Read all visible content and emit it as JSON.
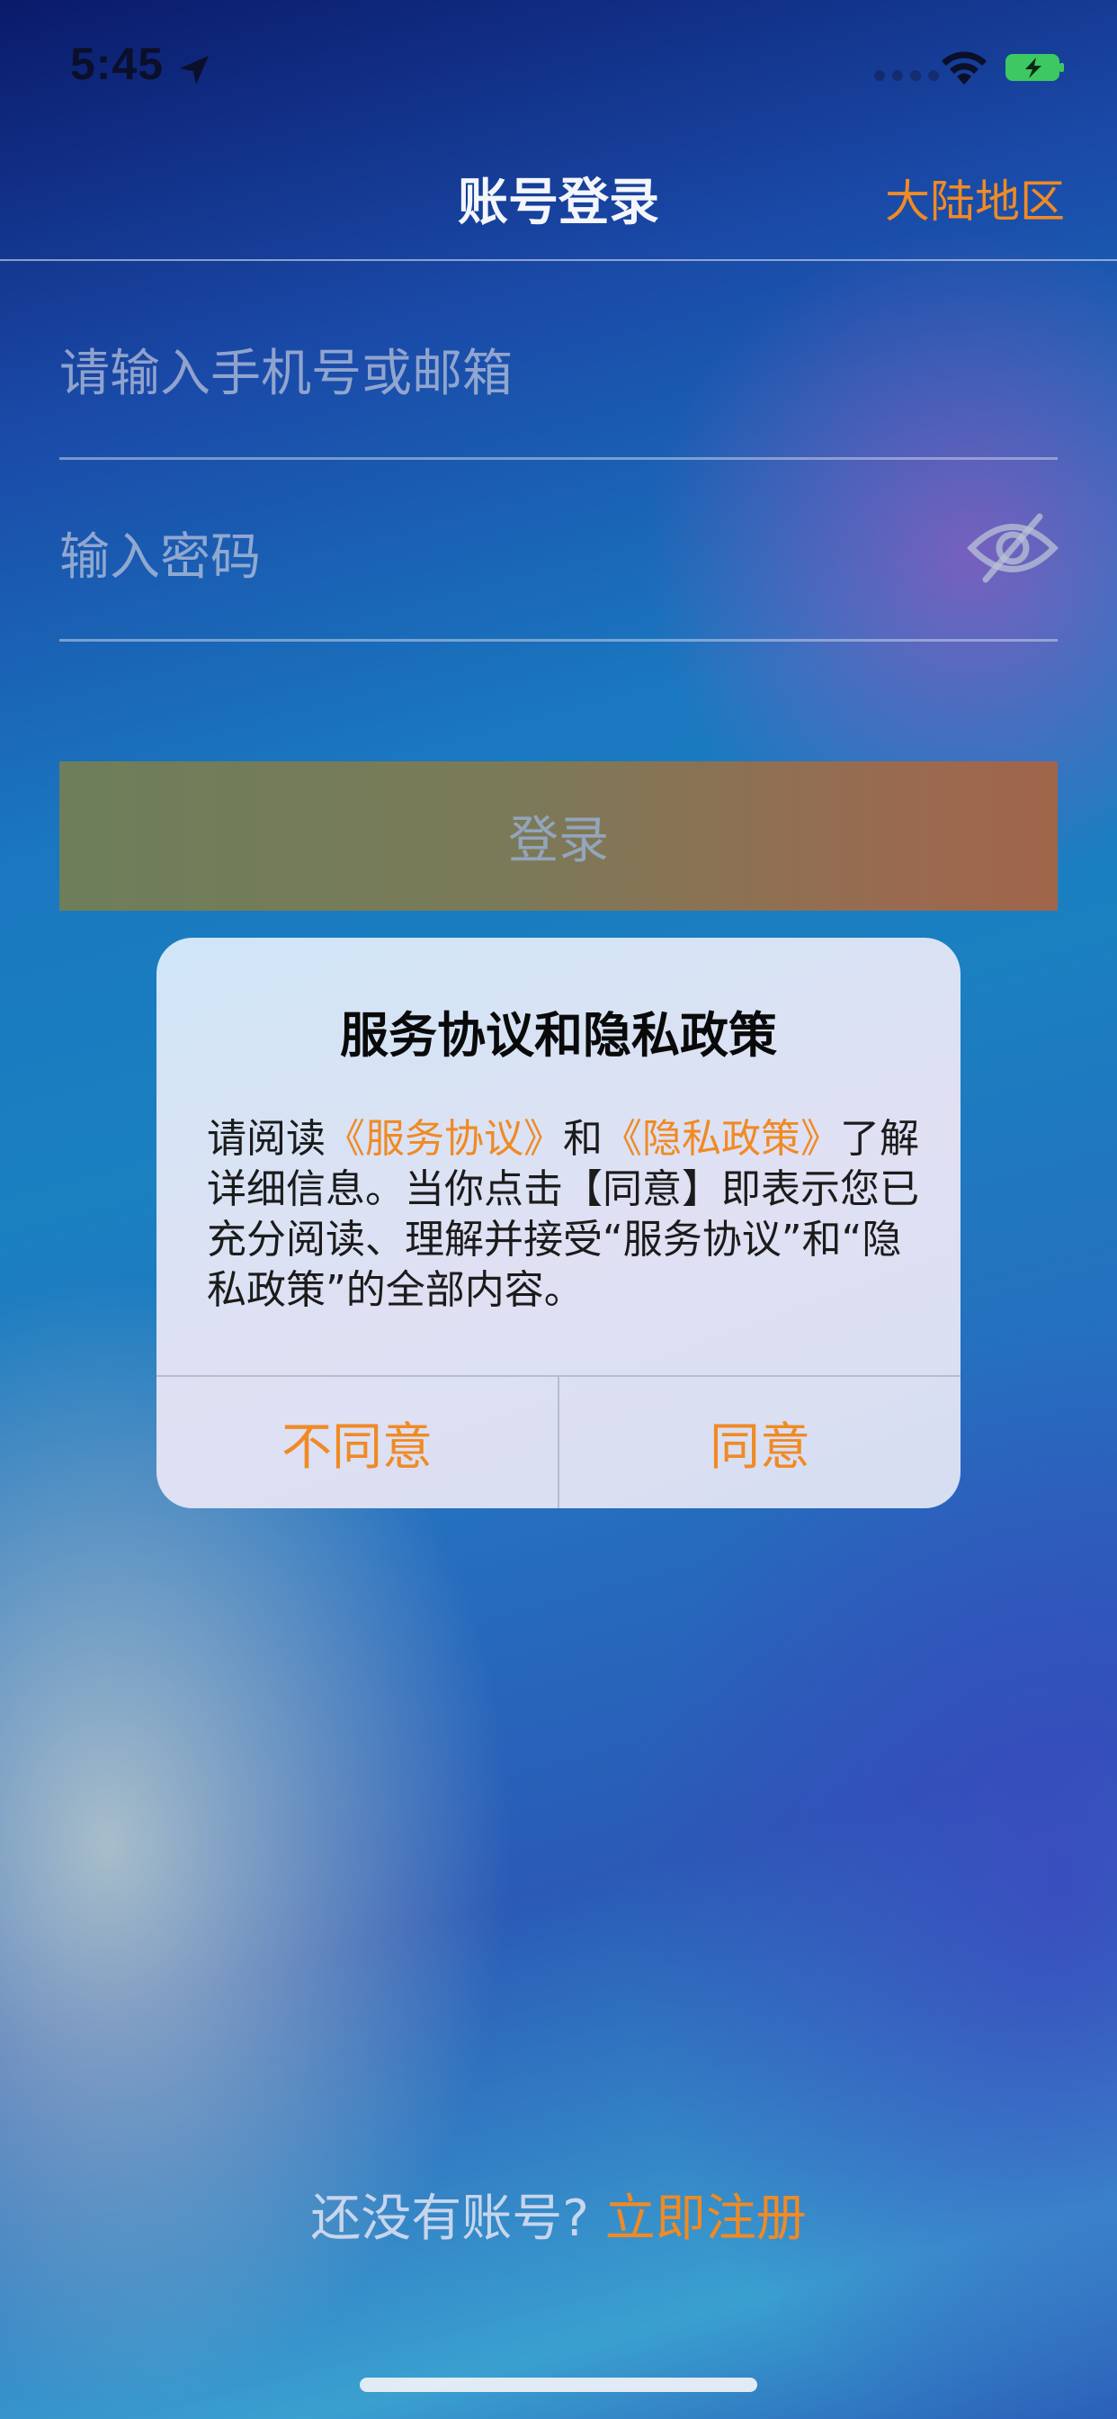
{
  "status_bar": {
    "time": "5:45"
  },
  "nav": {
    "title": "账号登录",
    "region": "大陆地区"
  },
  "form": {
    "account_placeholder": "请输入手机号或邮箱",
    "password_placeholder": "输入密码",
    "login_label": "登录"
  },
  "dialog": {
    "title": "服务协议和隐私政策",
    "body_prefix": "请阅读",
    "service_link": "《服务协议》",
    "and": "和",
    "privacy_link": "《隐私政策》",
    "body_rest": "了解详细信息。当你点击【同意】即表示您已充分阅读、理解并接受“服务协议”和“隐私政策”的全部内容。",
    "disagree_label": "不同意",
    "agree_label": "同意"
  },
  "footer": {
    "question": "还没有账号?",
    "register_label": "立即注册"
  },
  "colors": {
    "accent": "#f08a24"
  }
}
